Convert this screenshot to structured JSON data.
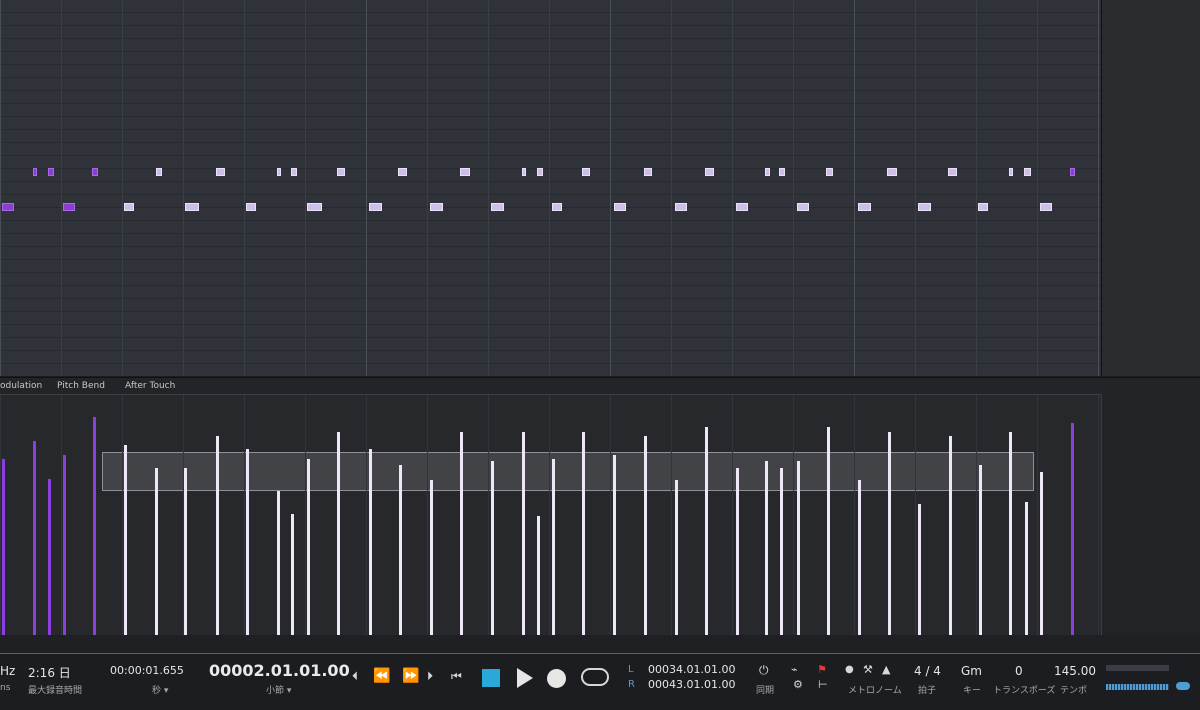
{
  "controller_tabs": [
    "odulation",
    "Pitch Bend",
    "After Touch"
  ],
  "transport": {
    "sample_rate_fragment": "Hz",
    "ms_fragment": "ns",
    "max_rec_value": "2:16 日",
    "max_rec_label": "最大録音時間",
    "time_value": "00:00:01.655",
    "time_unit": "秒 ▾",
    "position_value": "00002.01.01.00",
    "position_unit": "小節 ▾",
    "loop_L_label": "L",
    "loop_R_label": "R",
    "loop_L_value": "00034.01.01.00",
    "loop_R_value": "00043.01.01.00",
    "sync_label": "同期",
    "metronome_label": "メトロノーム",
    "time_sig_value": "4 / 4",
    "time_sig_label": "拍子",
    "key_value": "Gm",
    "key_label": "キー",
    "transpose_value": "0",
    "transpose_label": "トランスポーズ",
    "tempo_value": "145.00",
    "tempo_label": "テンポ"
  },
  "icons": {
    "rewind_start": "⏴",
    "rewind": "⏪",
    "ffwd": "⏩",
    "forward": "⏵",
    "to_start": "⏮",
    "power": "⏻",
    "gear": "⚙"
  },
  "colors": {
    "accent_blue": "#29a8d9",
    "selected_note": "#8a3fd1",
    "note": "#cdbfe8"
  }
}
